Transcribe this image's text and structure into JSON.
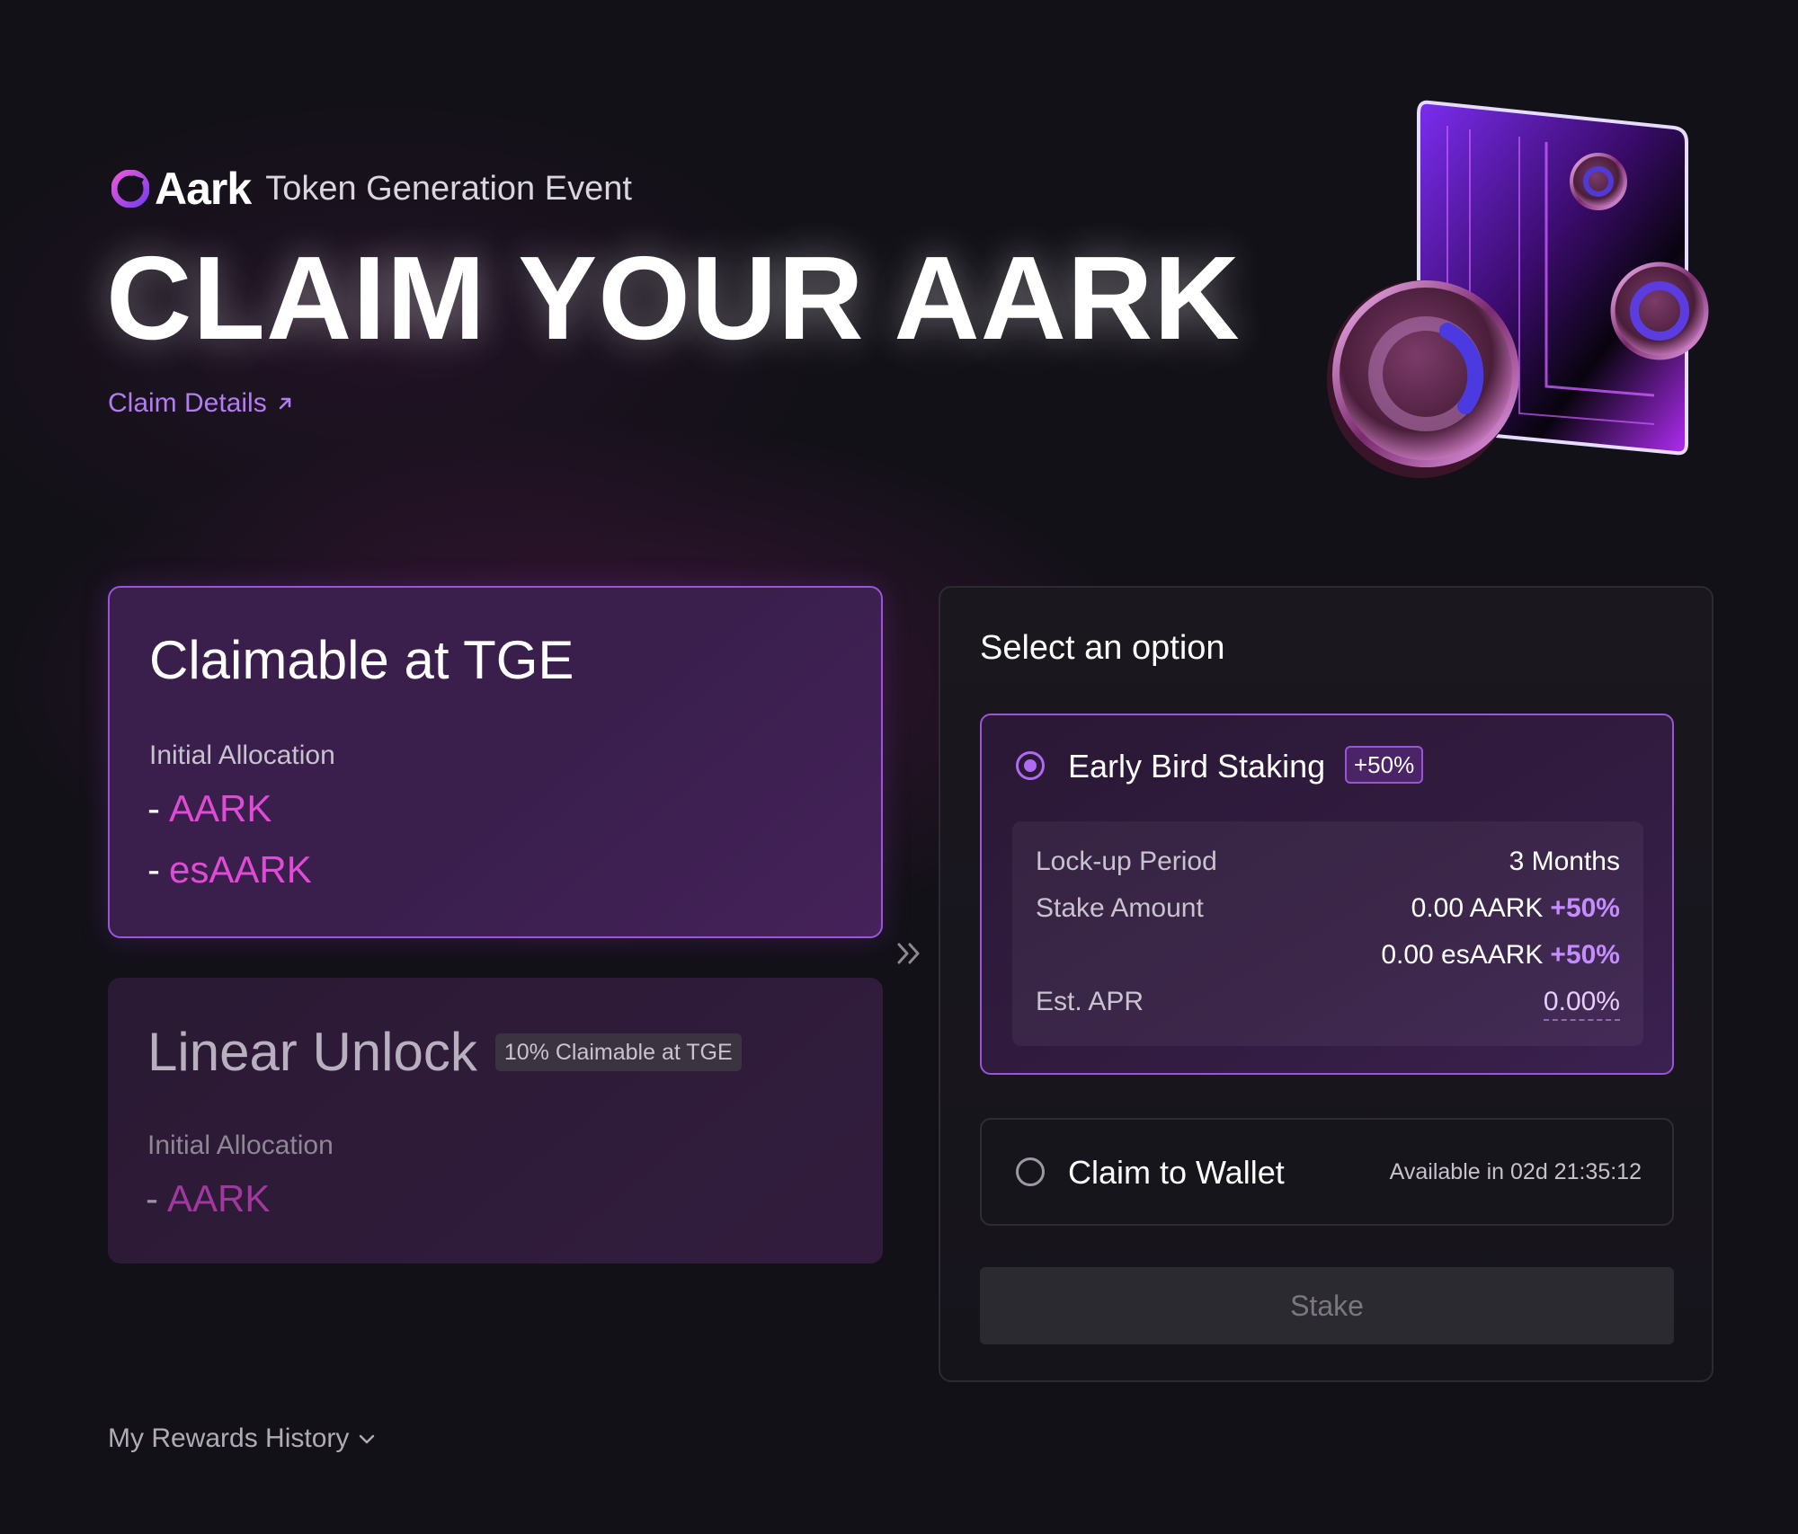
{
  "header": {
    "brand_name": "Aark",
    "brand_subtitle": "Token Generation Event",
    "hero_title": "CLAIM YOUR AARK",
    "claim_details_link": "Claim Details",
    "brand_accent": "#b069f2"
  },
  "claimable_card": {
    "title": "Claimable at TGE",
    "allocation_label": "Initial Allocation",
    "items": [
      {
        "dash": "-",
        "token": "AARK"
      },
      {
        "dash": "-",
        "token": "esAARK"
      }
    ]
  },
  "linear_card": {
    "title": "Linear Unlock",
    "badge": "10% Claimable at TGE",
    "allocation_label": "Initial Allocation",
    "items": [
      {
        "dash": "-",
        "token": "AARK"
      }
    ]
  },
  "options_panel": {
    "title": "Select an option",
    "early_bird": {
      "label": "Early Bird Staking",
      "badge": "+50%",
      "selected": true,
      "rows": {
        "lockup_label": "Lock-up Period",
        "lockup_value": "3 Months",
        "stake_label": "Stake Amount",
        "stake_aark": "0.00 AARK",
        "stake_aark_boost": "+50%",
        "stake_esaark": "0.00 esAARK",
        "stake_esaark_boost": "+50%",
        "apr_label": "Est. APR",
        "apr_value": "0.00%"
      }
    },
    "claim_wallet": {
      "label": "Claim to Wallet",
      "availability": "Available in 02d 21:35:12",
      "selected": false
    },
    "stake_button": "Stake"
  },
  "footer": {
    "history_label": "My Rewards History"
  },
  "icons": {
    "brand_logo": "aark-logo-icon",
    "external_link": "arrow-up-right-icon",
    "chevrons": "double-chevron-right-icon",
    "history_toggle": "chevron-down-icon"
  },
  "colors": {
    "background": "#131118",
    "primary_purple": "#9a55d8",
    "token_pink": "#e04bd5",
    "link_purple": "#b27cf2"
  }
}
